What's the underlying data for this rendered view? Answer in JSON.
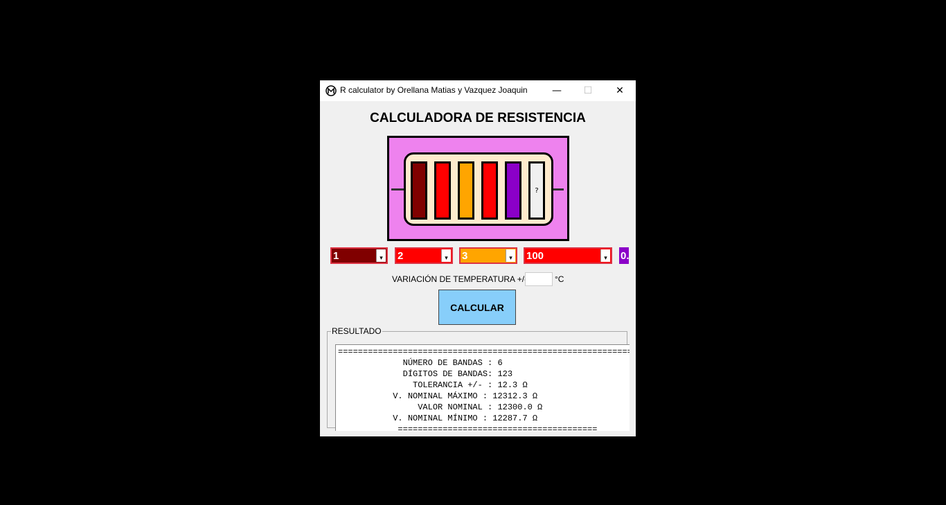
{
  "window": {
    "title": "R calculator by Orellana Matias y Vazquez Joaquin",
    "minimize": "—",
    "maximize": "☐",
    "close": "✕"
  },
  "heading": "CALCULADORA DE RESISTENCIA",
  "bands": [
    {
      "color": "#800000",
      "label": ""
    },
    {
      "color": "#ff0000",
      "label": ""
    },
    {
      "color": "#ffa500",
      "label": ""
    },
    {
      "color": "#ff0000",
      "label": ""
    },
    {
      "color": "#8b00c8",
      "label": ""
    },
    {
      "color": "#f0f0f0",
      "label": "?"
    }
  ],
  "selectors": [
    {
      "value": "1",
      "color": "#800000"
    },
    {
      "value": "2",
      "color": "#ff0000"
    },
    {
      "value": "3",
      "color": "#ffa500"
    },
    {
      "value": "100",
      "color": "#ff0000"
    },
    {
      "value": "0.",
      "color": "#8b00c8"
    }
  ],
  "temperature": {
    "label": "VARIACIÓN DE TEMPERATURA +/- :",
    "value": "",
    "unit": "°C"
  },
  "calculate_label": "CALCULAR",
  "result": {
    "group_label": "RESULTADO",
    "lines": [
      "=====================================================================",
      "             NÚMERO DE BANDAS : 6",
      "             DÍGITOS DE BANDAS: 123",
      "               TOLERANCIA +/- : 12.3 Ω",
      "           V. NOMINAL MÁXIMO : 12312.3 Ω",
      "                VALOR NOMINAL : 12300.0 Ω",
      "           V. NOMINAL MÍNIMO : 12287.7 Ω",
      "            ========================================"
    ]
  }
}
